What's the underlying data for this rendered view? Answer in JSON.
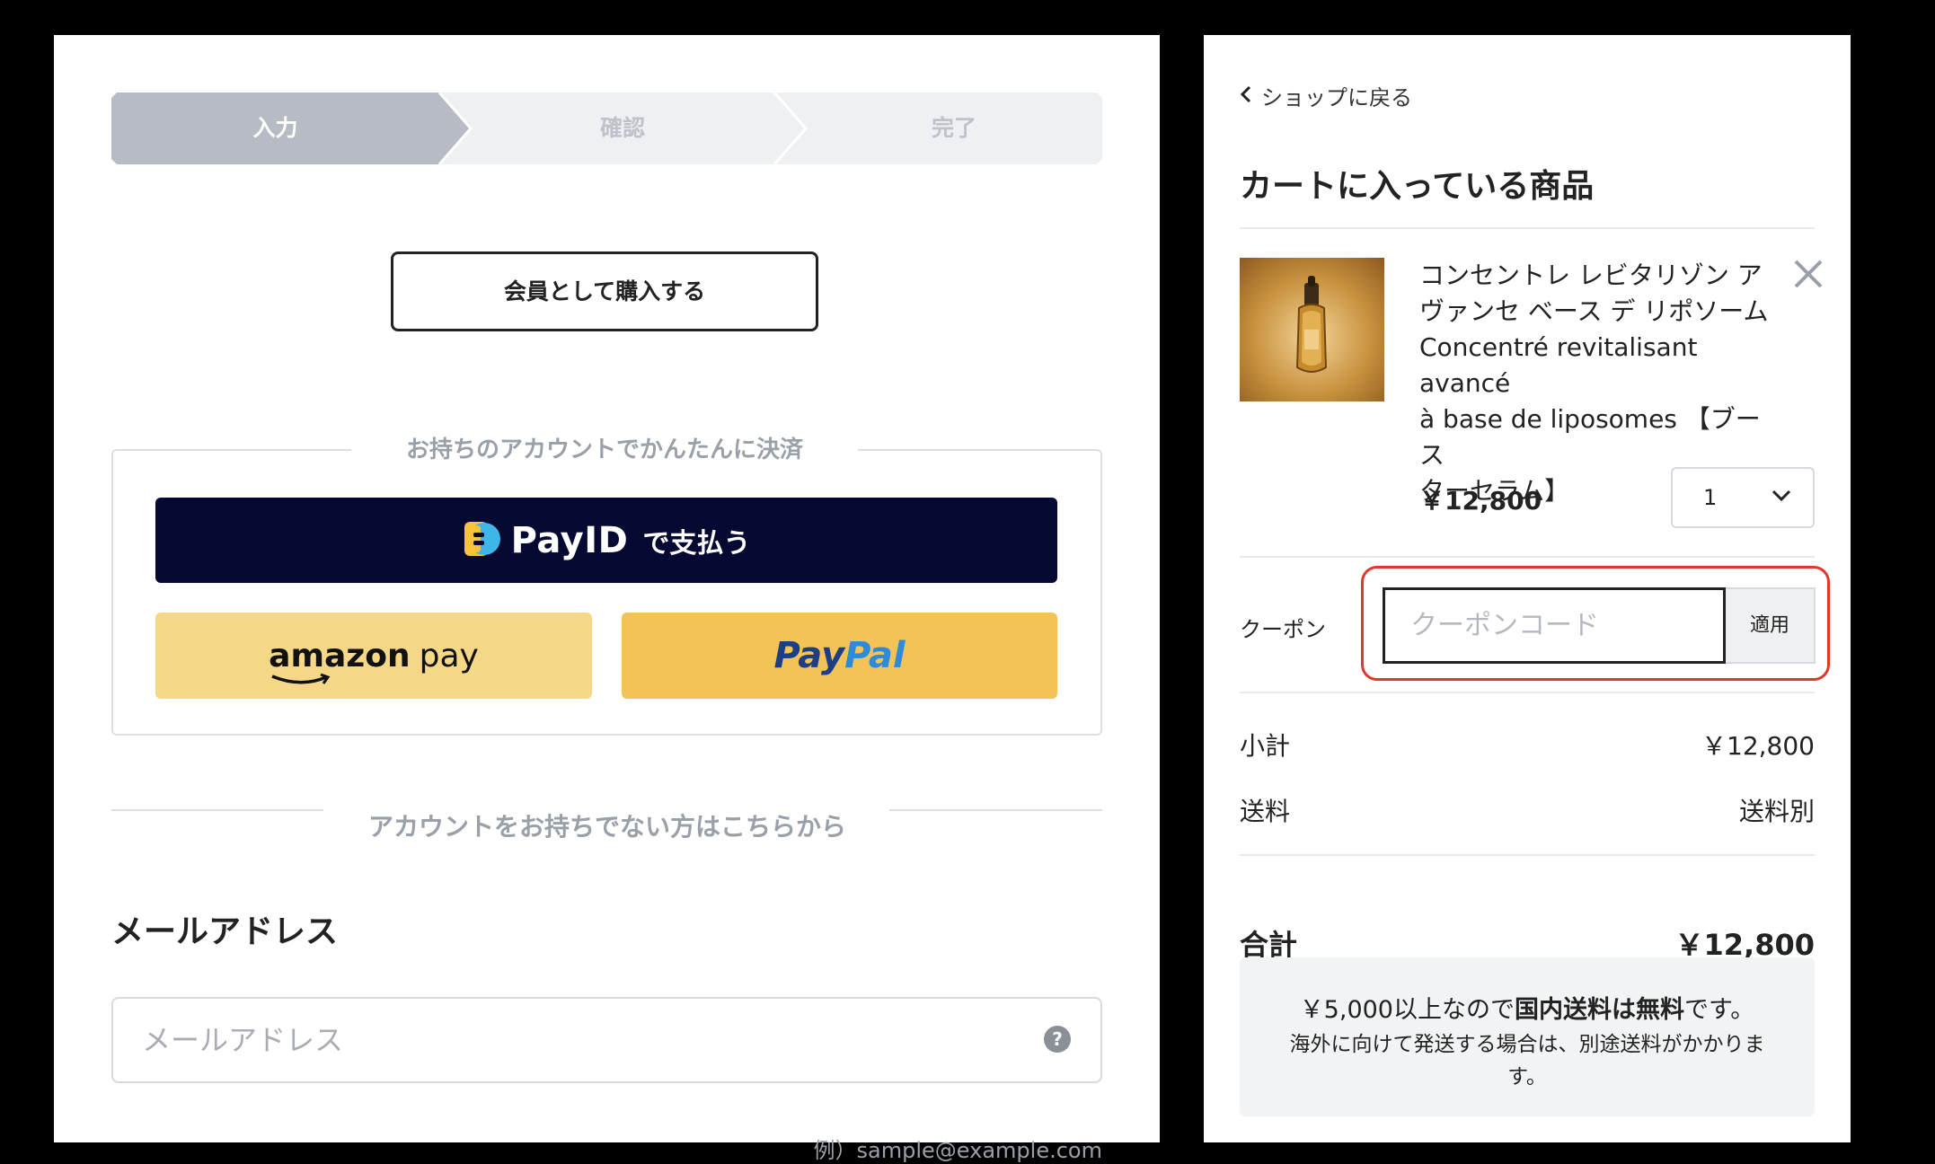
{
  "checkout": {
    "steps": [
      {
        "label": "入力",
        "state": "active"
      },
      {
        "label": "確認",
        "state": "inactive"
      },
      {
        "label": "完了",
        "state": "inactive"
      }
    ],
    "member_button": "会員として購入する",
    "account_section_label": "お持ちのアカウントでかんたんに決済",
    "payid": {
      "brand": "PayID",
      "text": "で支払う"
    },
    "amazon_pay": {
      "word": "amazon",
      "pay": "pay"
    },
    "paypal": {
      "pay": "Pay",
      "pal": "Pal"
    },
    "no_account_label": "アカウントをお持ちでない方はこちらから",
    "email": {
      "title": "メールアドレス",
      "placeholder": "メールアドレス",
      "help": "?",
      "example": "例）sample@example.com"
    }
  },
  "cart": {
    "back_link": "ショップに戻る",
    "title": "カートに入っている商品",
    "item": {
      "name_lines": [
        "コンセントレ レビタリゾン ア",
        "ヴァンセ ベース デ リポソーム",
        "Concentré revitalisant avancé",
        "à base de liposomes 【ブース",
        "ターセラム】"
      ],
      "price": "￥12,800",
      "quantity": "1"
    },
    "coupon": {
      "label": "クーポン",
      "placeholder": "クーポンコード",
      "apply": "適用"
    },
    "subtotal": {
      "label": "小計",
      "value": "￥12,800"
    },
    "shipping": {
      "label": "送料",
      "value": "送料別"
    },
    "total": {
      "label": "合計",
      "value": "￥12,800"
    },
    "notice": {
      "prefix": "￥5,000以上なので",
      "bold": "国内送料は無料",
      "suffix": "です。",
      "line2": "海外に向けて発送する場合は、別途送料がかかります。"
    }
  },
  "colors": {
    "step_active": "#b7bcc4",
    "step_inactive": "#eef0f3",
    "payid_bg": "#060a33",
    "amazon_bg": "#f5d887",
    "paypal_bg": "#f4c357",
    "coupon_highlight": "#e0392b"
  }
}
